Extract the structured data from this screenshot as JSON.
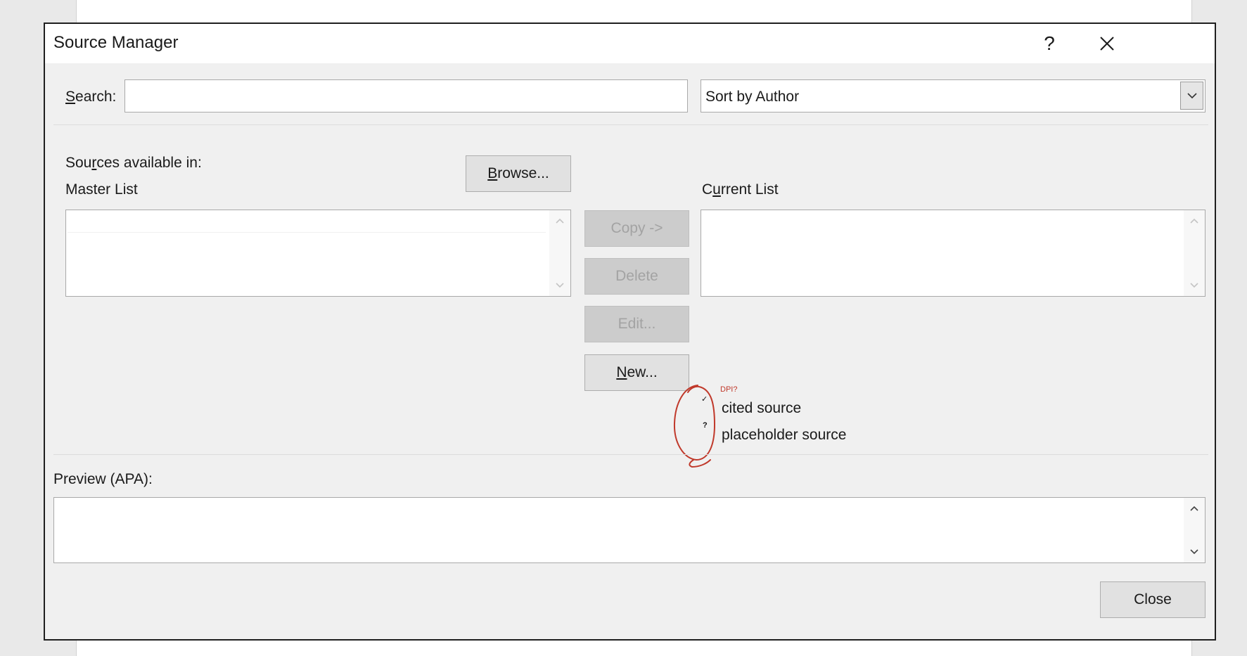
{
  "dialog": {
    "title": "Source Manager",
    "help_glyph": "?",
    "close_glyph": "✕"
  },
  "search": {
    "label_before": "",
    "label_accel": "S",
    "label_after": "earch:",
    "value": "",
    "placeholder": ""
  },
  "sort": {
    "selected": "Sort by Author"
  },
  "sources": {
    "available_label_before": "Sou",
    "available_label_accel": "r",
    "available_label_after": "ces available in:",
    "master_label": "Master List",
    "current_label_before": "C",
    "current_label_accel": "u",
    "current_label_after": "rrent List",
    "browse_accel": "B",
    "browse_rest": "rowse..."
  },
  "actions": {
    "copy": "Copy ->",
    "delete": "Delete",
    "edit": "Edit...",
    "new_accel": "N",
    "new_rest": "ew..."
  },
  "legend": {
    "cited_mark": "✓",
    "cited_label": "cited source",
    "placeholder_mark": "?",
    "placeholder_label": "placeholder source"
  },
  "annotation": {
    "note": "DPI?",
    "color": "#c0392b"
  },
  "preview": {
    "label": "Preview (APA):"
  },
  "footer": {
    "close": "Close"
  }
}
